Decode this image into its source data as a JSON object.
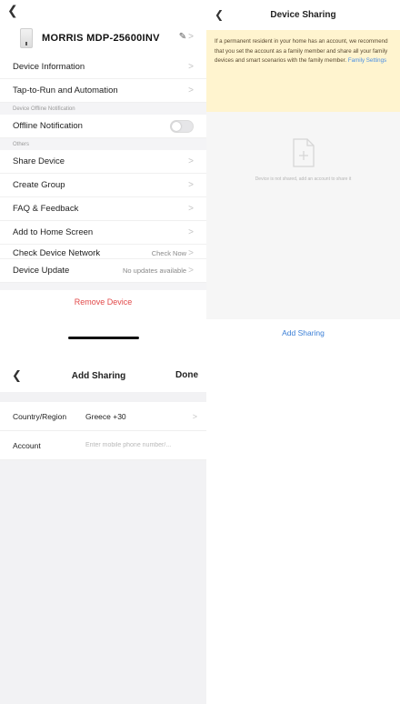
{
  "device_settings": {
    "back_icon": "chevron-left",
    "device_name": "MORRIS MDP-25600INV",
    "edit_icon": "pencil",
    "rows_a": [
      {
        "label": "Device Information"
      },
      {
        "label": "Tap-to-Run and Automation"
      }
    ],
    "section_offline": "Device Offline Notification",
    "offline_label": "Offline Notification",
    "offline_enabled": false,
    "section_others": "Others",
    "rows_b": [
      {
        "label": "Share Device"
      },
      {
        "label": "Create Group"
      },
      {
        "label": "FAQ & Feedback"
      },
      {
        "label": "Add to Home Screen"
      }
    ],
    "check_network": {
      "label": "Check Device Network",
      "value": "Check Now"
    },
    "device_update": {
      "label": "Device Update",
      "value": "No updates available"
    },
    "remove_label": "Remove Device"
  },
  "device_sharing": {
    "back_icon": "chevron-left",
    "title": "Device Sharing",
    "notice_text": "If a permanent resident in your home has an account, we recommend that you set the account as a family member and share all your family devices and smart scenarios with the family member.",
    "notice_link": "Family Settings",
    "empty_icon": "document-icon",
    "empty_text": "Device is not shared, add an account to share it",
    "add_button": "Add Sharing"
  },
  "add_sharing": {
    "back_icon": "chevron-left",
    "title": "Add Sharing",
    "done_label": "Done",
    "country_label": "Country/Region",
    "country_value": "Greece +30",
    "account_label": "Account",
    "account_placeholder": "Enter mobile phone number/..."
  },
  "colors": {
    "accent_blue": "#3b7fd6",
    "danger_red": "#e24a4a",
    "notice_bg": "#fff4cf"
  }
}
